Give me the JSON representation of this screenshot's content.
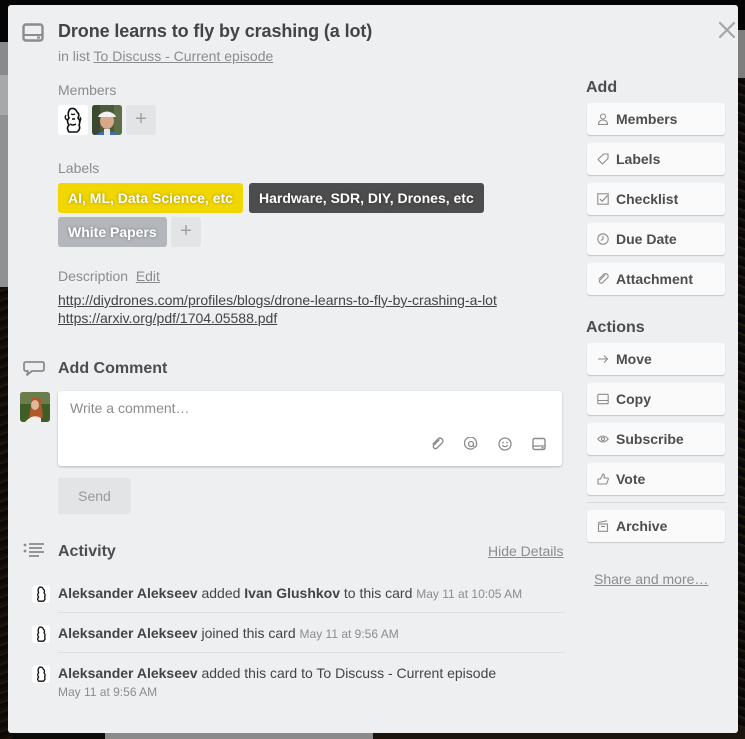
{
  "card": {
    "title": "Drone learns to fly by crashing (a lot)",
    "in_list_prefix": "in list",
    "list_name": "To Discuss - Current episode"
  },
  "members": {
    "heading": "Members",
    "items": [
      {
        "name": "Aleksander Alekseev",
        "avatar": "cartoon-sketch-avatar"
      },
      {
        "name": "Ivan Glushkov",
        "avatar": "photo-avatar-cap"
      }
    ],
    "add_label": "+"
  },
  "labels": {
    "heading": "Labels",
    "items": [
      {
        "text": "AI, ML, Data Science, etc",
        "color": "#f2d600"
      },
      {
        "text": "Hardware, SDR, DIY, Drones, etc",
        "color": "#4d4d4d"
      },
      {
        "text": "White Papers",
        "color": "#b3b6ba"
      }
    ],
    "add_label": "+"
  },
  "description": {
    "heading": "Description",
    "edit_label": "Edit",
    "links": [
      "http://diydrones.com/profiles/blogs/drone-learns-to-fly-by-crashing-a-lot",
      "https://arxiv.org/pdf/1704.05588.pdf"
    ]
  },
  "comment": {
    "heading": "Add Comment",
    "placeholder": "Write a comment…",
    "send_label": "Send",
    "icons": [
      "attachment-icon",
      "mention-icon",
      "emoji-icon",
      "card-icon"
    ]
  },
  "activity": {
    "heading": "Activity",
    "hide_details_label": "Hide Details",
    "items": [
      {
        "actor": "Aleksander Alekseev",
        "verb": "added",
        "object": "Ivan Glushkov",
        "suffix": "to this card",
        "time": "May 11 at 10:05 AM"
      },
      {
        "actor": "Aleksander Alekseev",
        "verb": "joined this card",
        "object": "",
        "suffix": "",
        "time": "May 11 at 9:56 AM"
      },
      {
        "actor": "Aleksander Alekseev",
        "verb": "added this card to To Discuss - Current episode",
        "object": "",
        "suffix": "",
        "time": "May 11 at 9:56 AM"
      }
    ]
  },
  "sidebar": {
    "add_heading": "Add",
    "add_buttons": [
      {
        "label": "Members",
        "icon": "person-icon"
      },
      {
        "label": "Labels",
        "icon": "tag-icon"
      },
      {
        "label": "Checklist",
        "icon": "checkbox-icon"
      },
      {
        "label": "Due Date",
        "icon": "clock-icon"
      },
      {
        "label": "Attachment",
        "icon": "paperclip-icon"
      }
    ],
    "actions_heading": "Actions",
    "action_buttons": [
      {
        "label": "Move",
        "icon": "arrow-right-icon"
      },
      {
        "label": "Copy",
        "icon": "card-icon"
      },
      {
        "label": "Subscribe",
        "icon": "eye-icon"
      },
      {
        "label": "Vote",
        "icon": "thumbs-up-icon"
      },
      {
        "label": "Archive",
        "icon": "archive-icon"
      }
    ],
    "share_label": "Share and more…"
  }
}
